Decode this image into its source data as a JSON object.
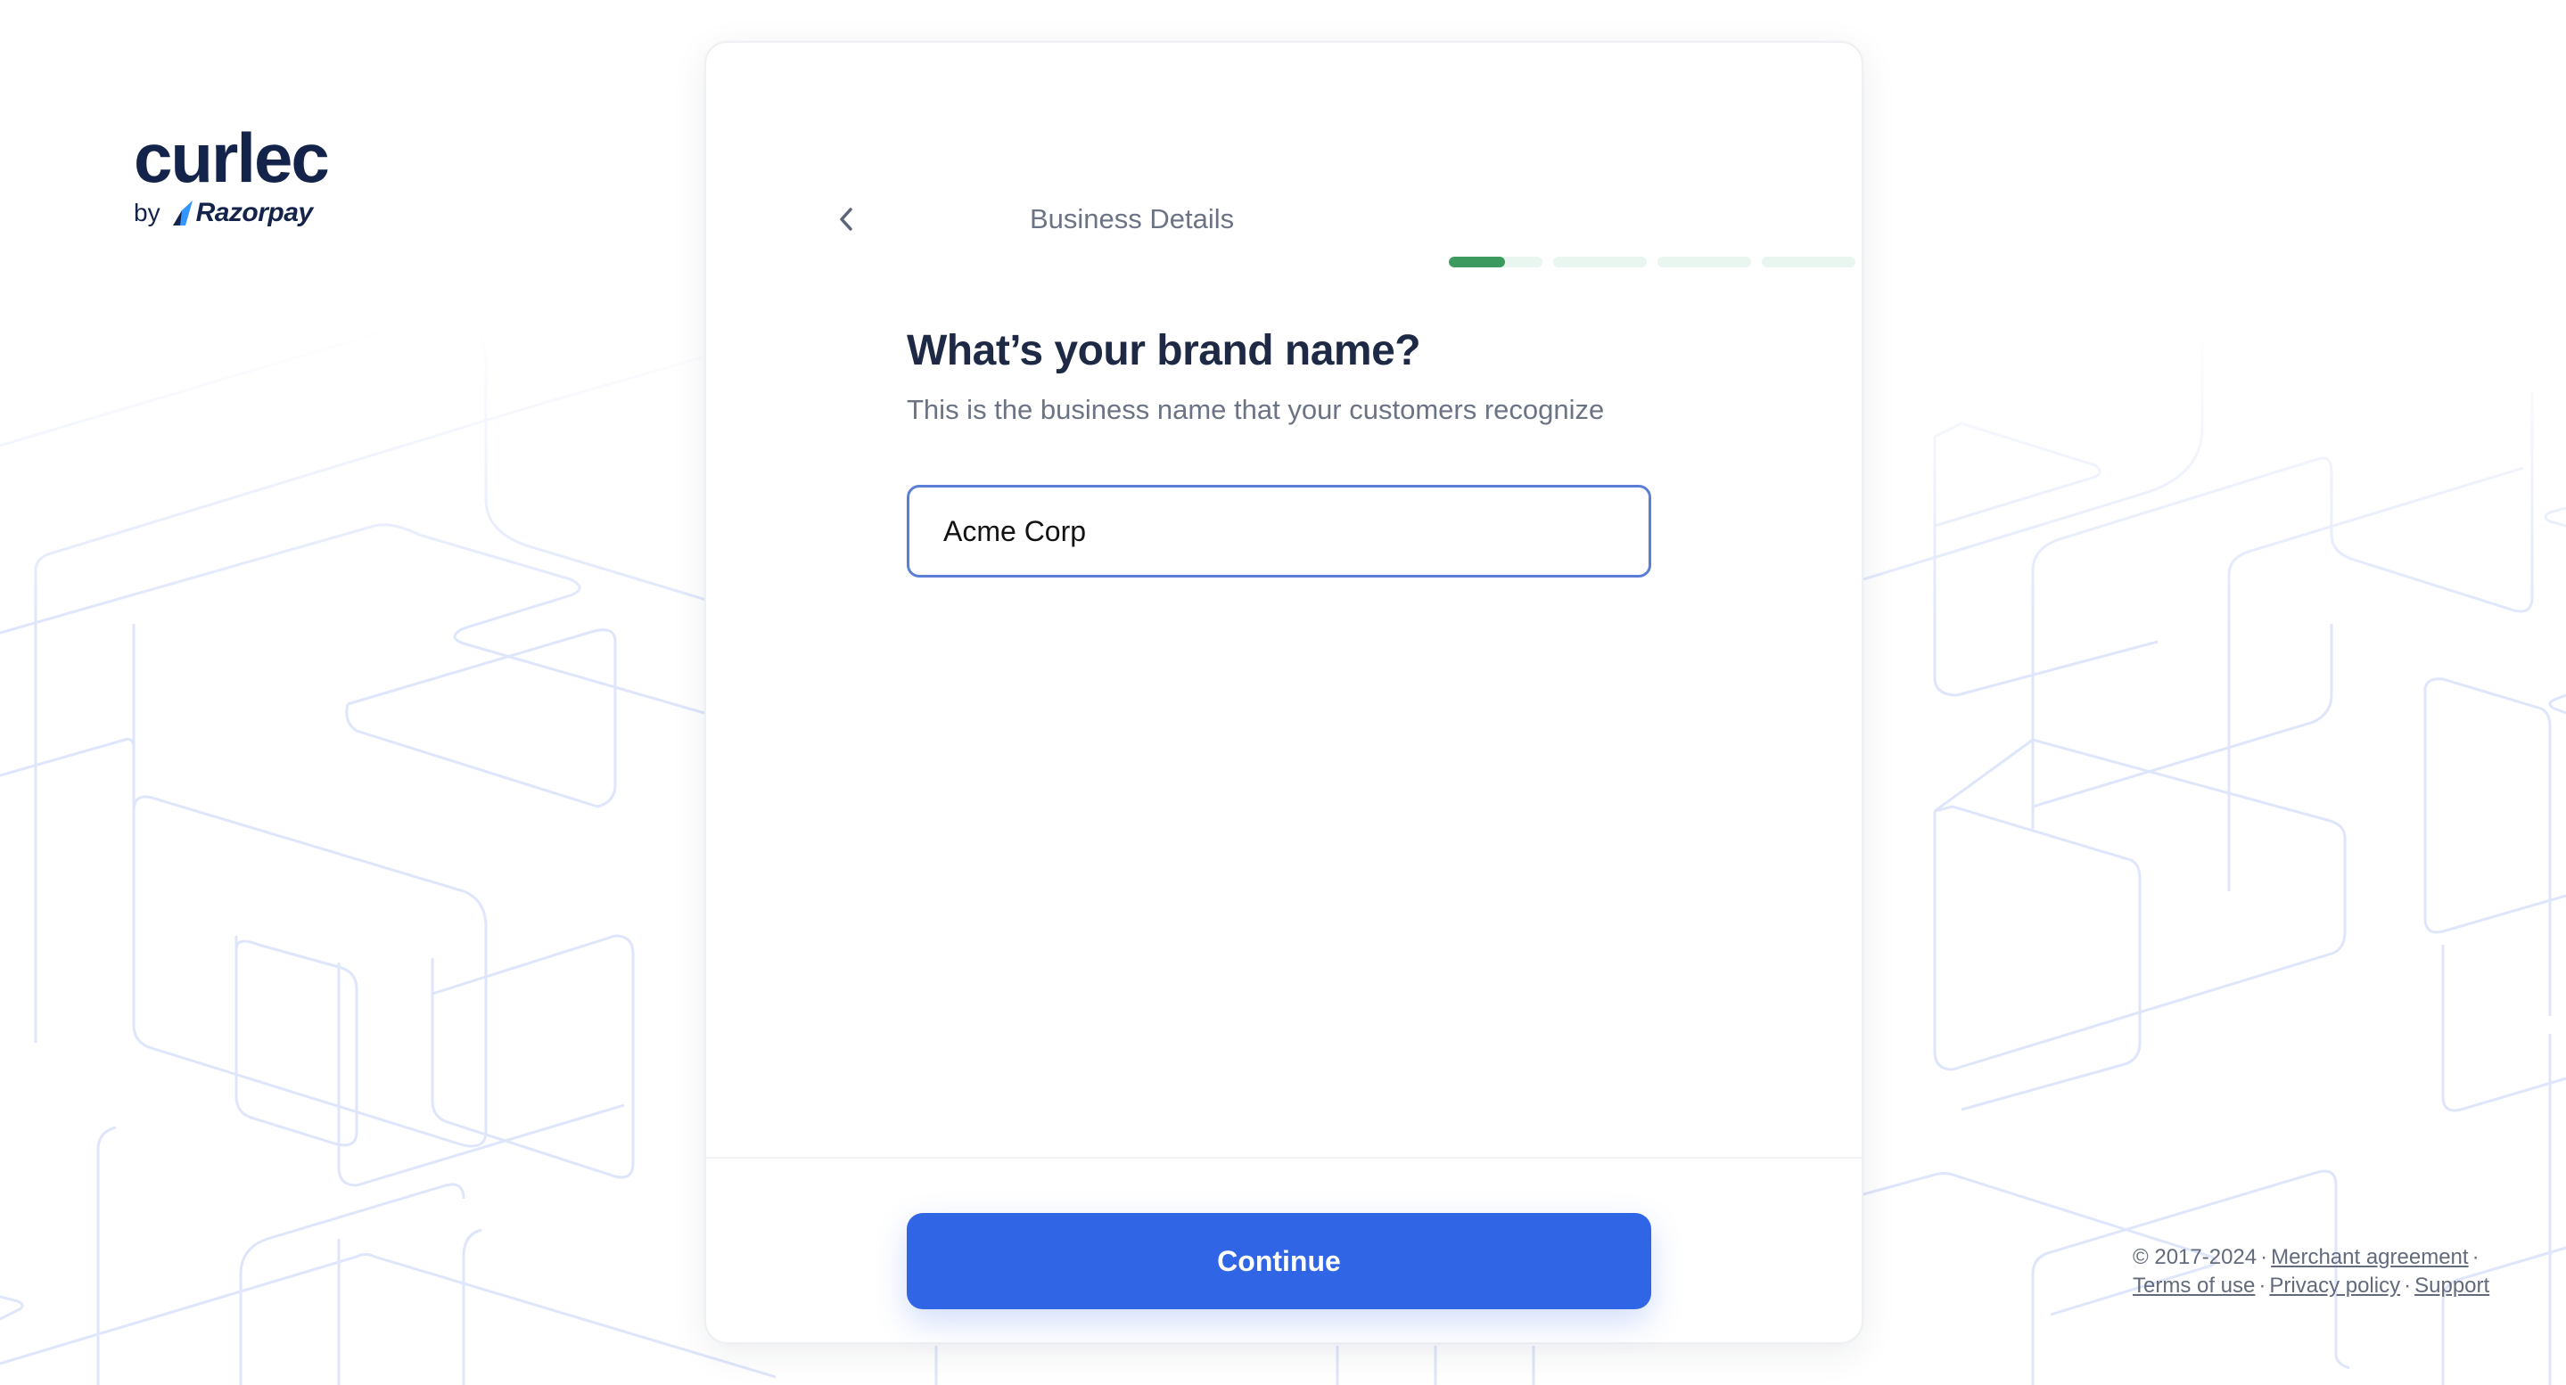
{
  "brand": {
    "name": "curlec",
    "by_label": "by",
    "parent_name": "Razorpay"
  },
  "header": {
    "back_icon": "chevron-left-icon",
    "step_title": "Business Details",
    "progress": {
      "segments": 4,
      "current_segment": 1,
      "current_segment_fill": 0.6,
      "fill_color": "#3d9a5e",
      "track_color": "#e8f6ef"
    }
  },
  "form": {
    "question": "What’s your brand name?",
    "hint": "This is the business name that your customers recognize",
    "brand_name_value": "Acme Corp"
  },
  "actions": {
    "continue_label": "Continue",
    "continue_color": "#3065e6"
  },
  "footer": {
    "copyright": "© 2017-2024",
    "separator": "·",
    "links": [
      "Merchant agreement",
      "Terms of use",
      "Privacy policy",
      "Support"
    ]
  }
}
